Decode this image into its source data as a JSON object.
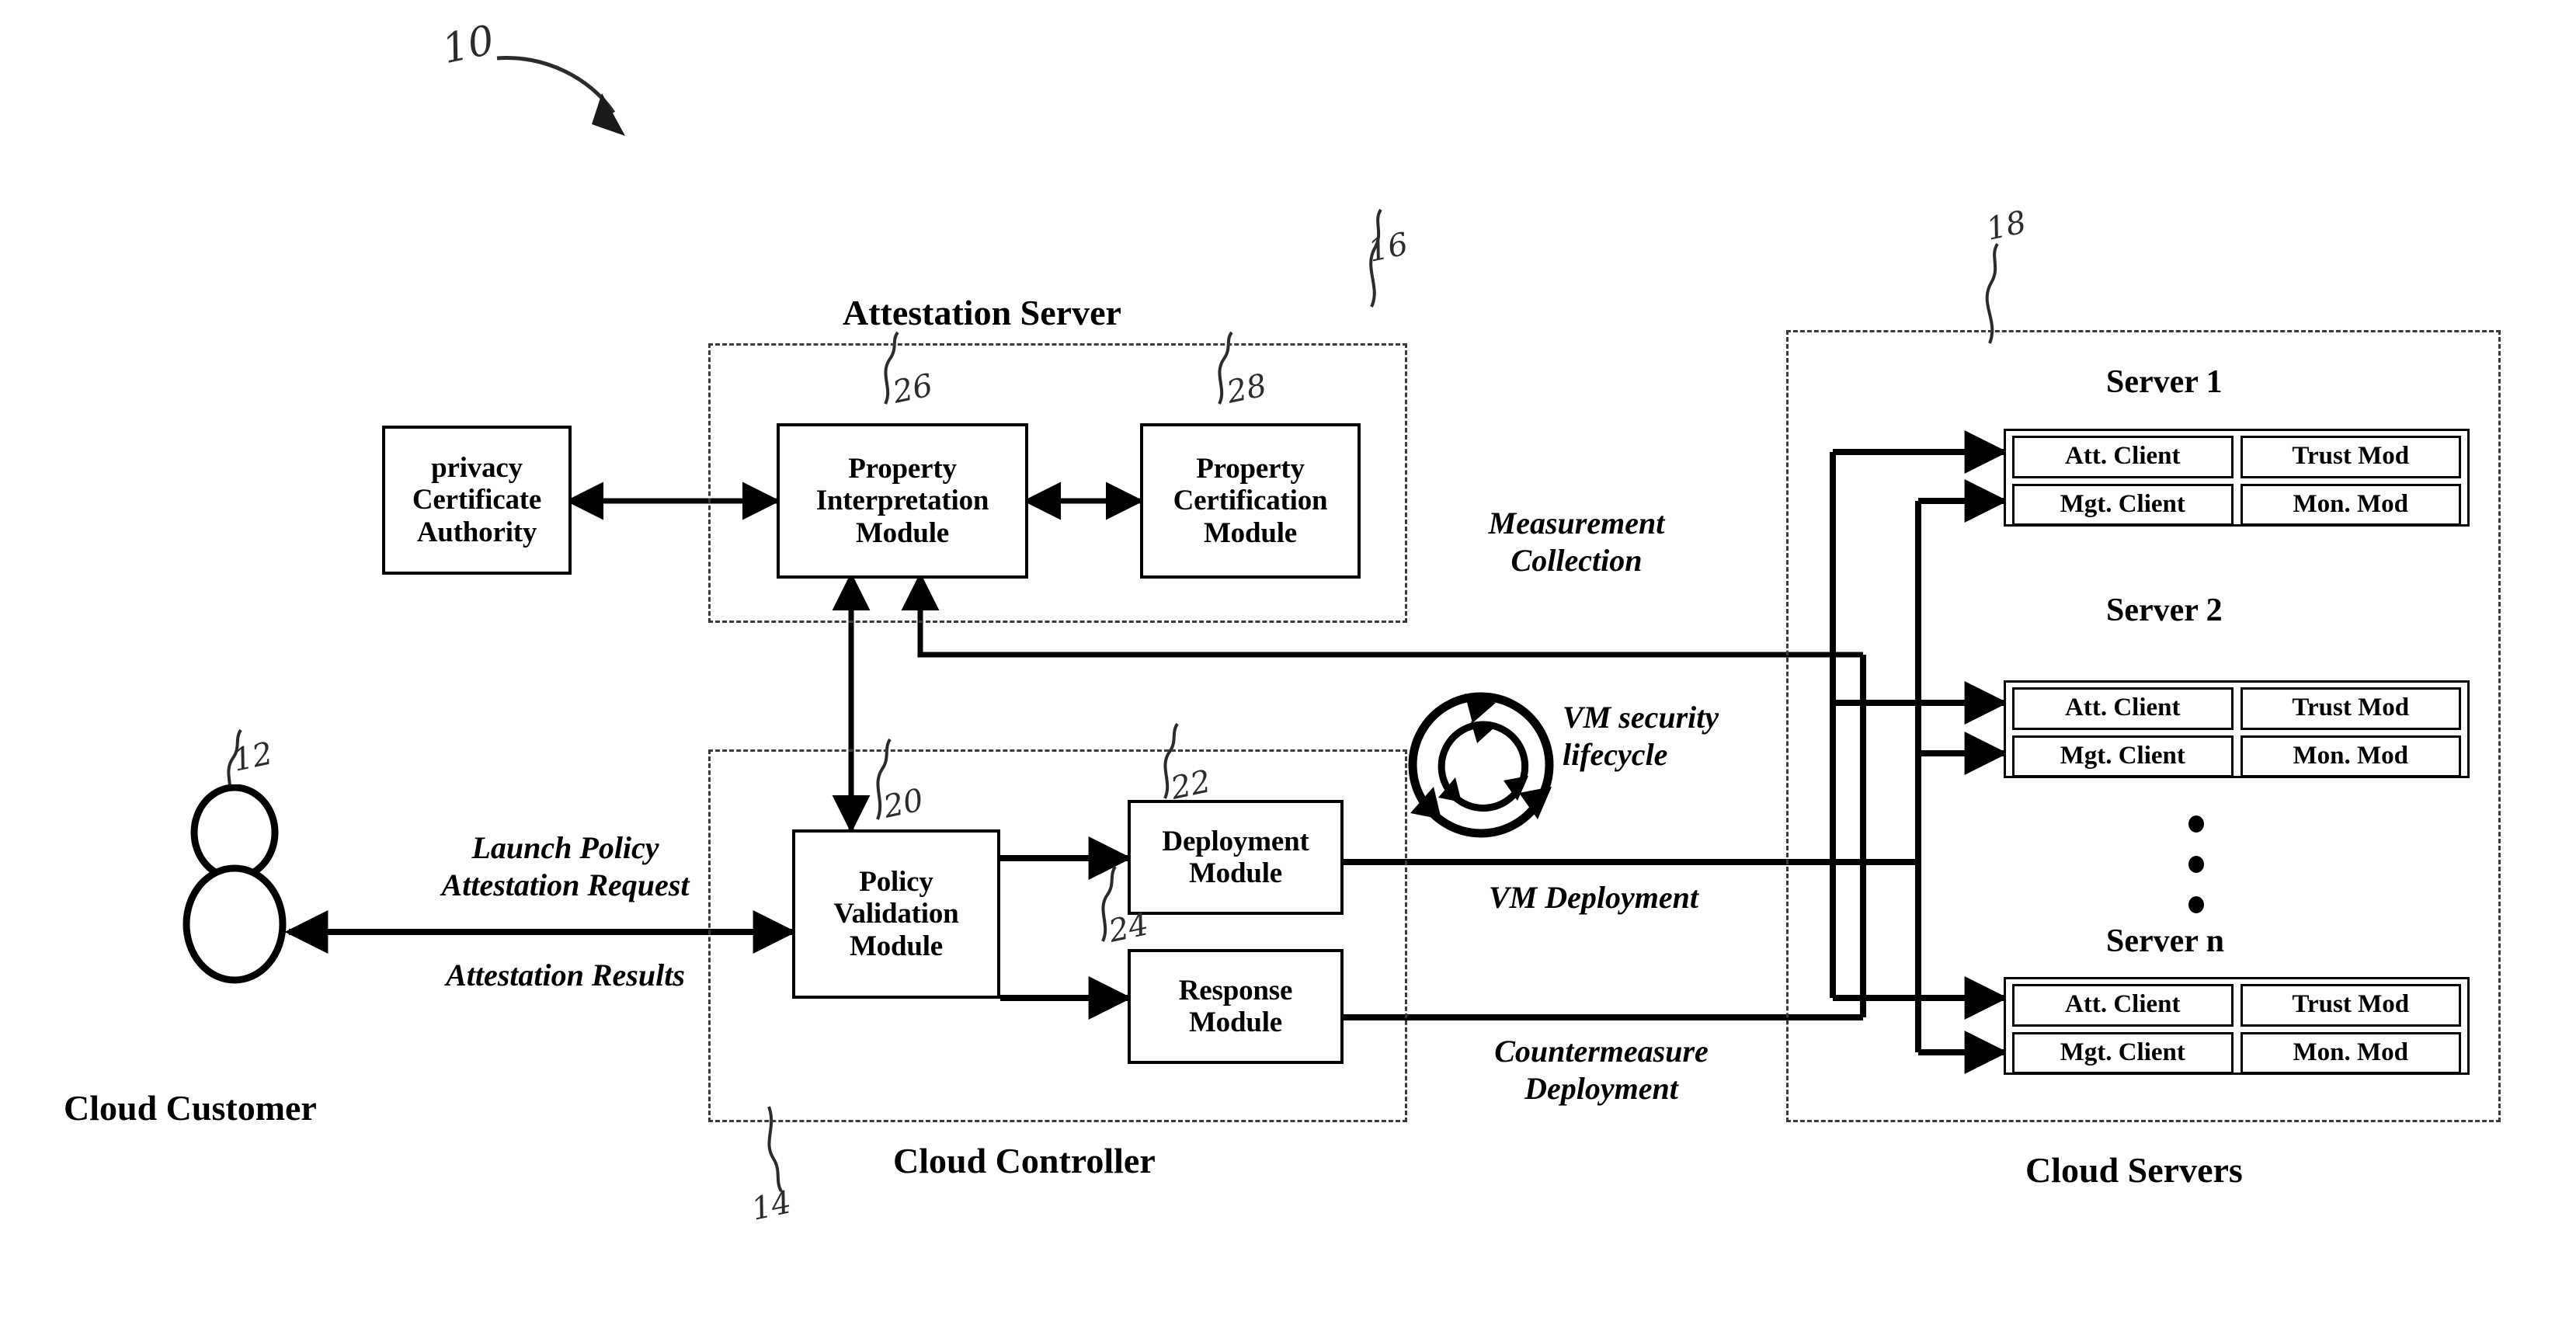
{
  "figure": {
    "number": "10"
  },
  "regions": [
    {
      "id": "attestation_server",
      "title": "Attestation Server",
      "ref": "16"
    },
    {
      "id": "cloud_controller",
      "title": "Cloud Controller",
      "ref": "14"
    },
    {
      "id": "cloud_servers",
      "title": "Cloud Servers",
      "ref": "18"
    }
  ],
  "boxes": {
    "privacy_ca": {
      "lines": [
        "privacy",
        "Certificate",
        "Authority"
      ],
      "ref": ""
    },
    "prop_interp": {
      "lines": [
        "Property",
        "Interpretation",
        "Module"
      ],
      "ref": "26"
    },
    "prop_cert": {
      "lines": [
        "Property",
        "Certification",
        "Module"
      ],
      "ref": "28"
    },
    "policy_val": {
      "lines": [
        "Policy",
        "Validation",
        "Module"
      ],
      "ref": "20"
    },
    "deployment": {
      "lines": [
        "Deployment",
        "Module"
      ],
      "ref": "22"
    },
    "response": {
      "lines": [
        "Response",
        "Module"
      ],
      "ref": "24"
    }
  },
  "actor": {
    "label": "Cloud Customer",
    "ref": "12"
  },
  "flows": {
    "launch_policy": "Launch Policy",
    "attestation_request": "Attestation Request",
    "attestation_results": "Attestation Results",
    "measurement_collection_l1": "Measurement",
    "measurement_collection_l2": "Collection",
    "vm_lifecycle_l1": "VM security",
    "vm_lifecycle_l2": "lifecycle",
    "vm_deployment": "VM Deployment",
    "countermeasure_l1": "Countermeasure",
    "countermeasure_l2": "Deployment"
  },
  "servers": [
    {
      "name": "Server 1",
      "cells": [
        [
          "Att. Client",
          "Trust Mod"
        ],
        [
          "Mgt. Client",
          "Mon. Mod"
        ]
      ]
    },
    {
      "name": "Server 2",
      "cells": [
        [
          "Att. Client",
          "Trust Mod"
        ],
        [
          "Mgt. Client",
          "Mon. Mod"
        ]
      ]
    },
    {
      "name": "Server n",
      "cells": [
        [
          "Att. Client",
          "Trust Mod"
        ],
        [
          "Mgt. Client",
          "Mon. Mod"
        ]
      ]
    }
  ],
  "ellipsis": "vertical-dots",
  "colors": {
    "ink": "#000000",
    "dash": "#3a3a3a",
    "pencil": "#2b2b2b"
  }
}
